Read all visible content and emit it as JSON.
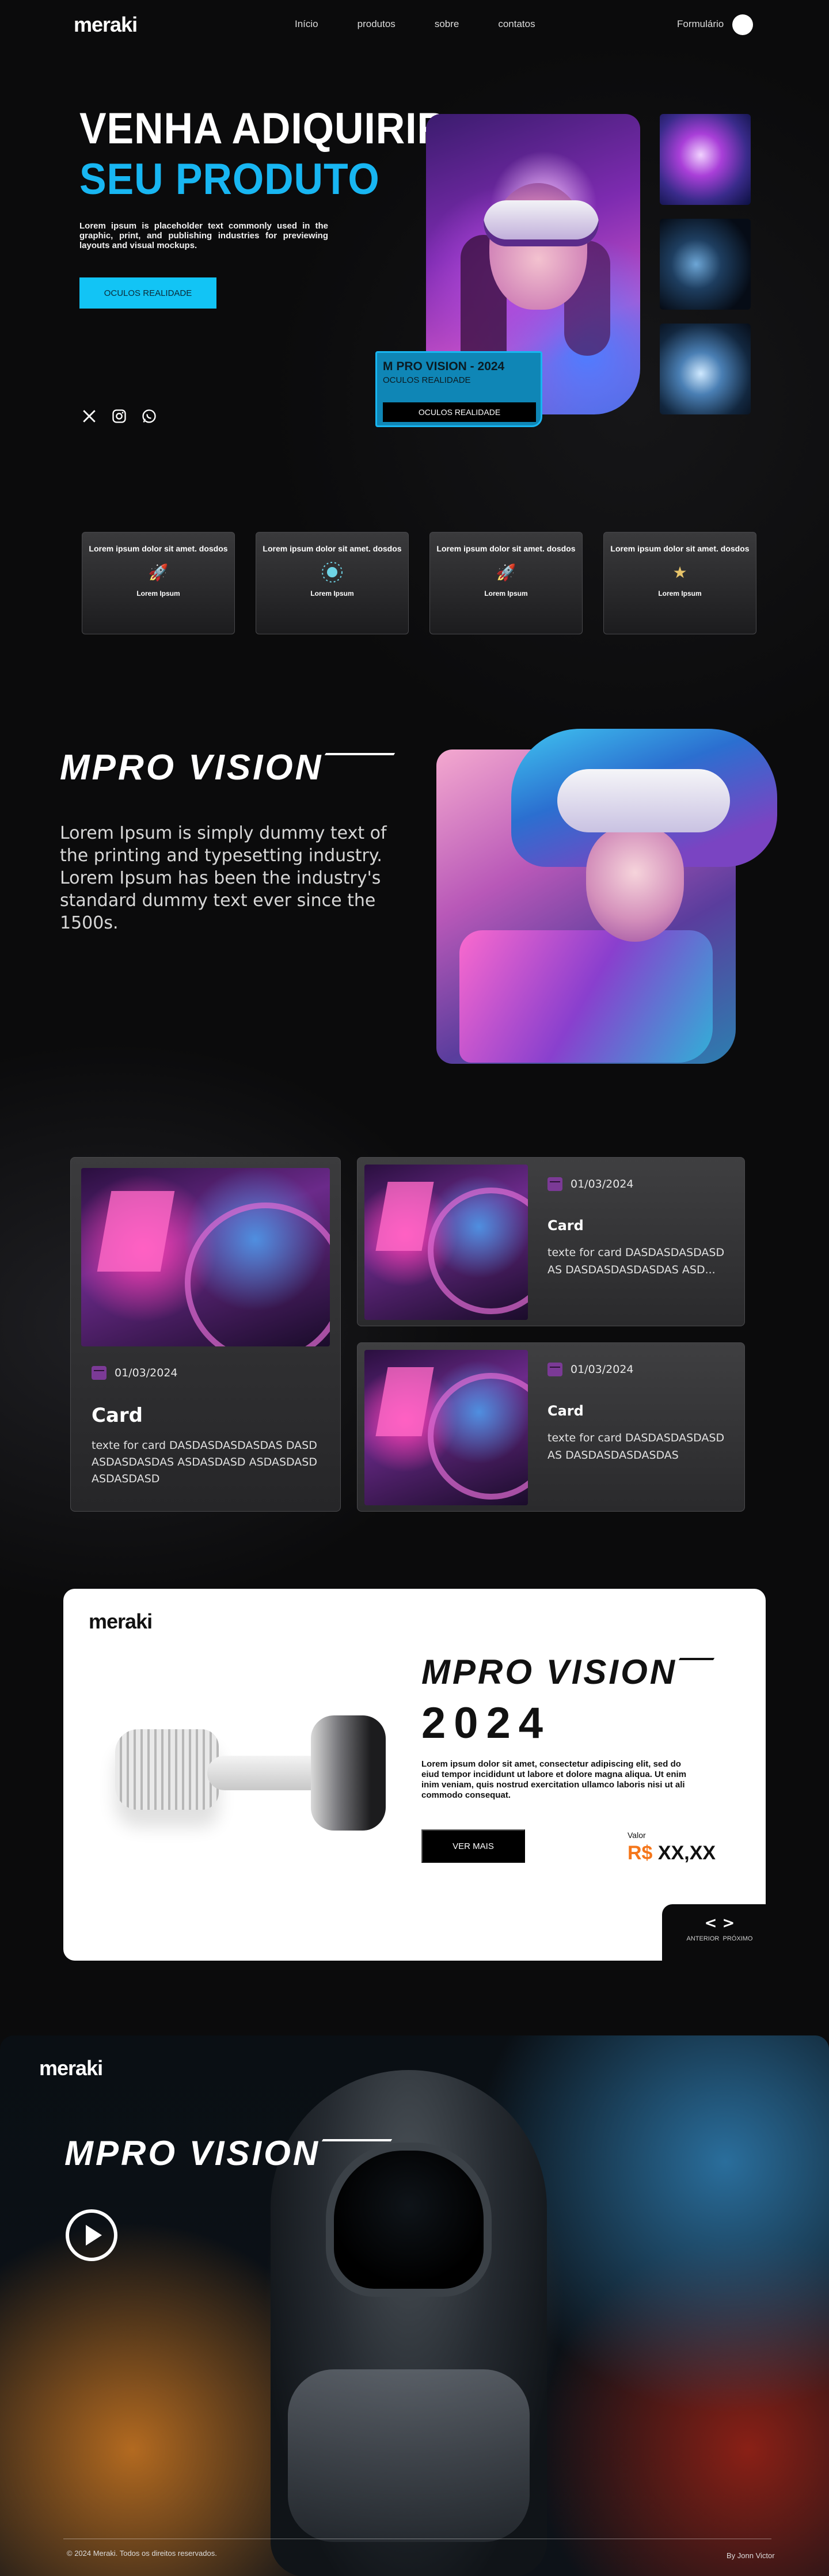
{
  "nav": {
    "logo": "meraki",
    "links": [
      "Início",
      "produtos",
      "sobre",
      "contatos"
    ],
    "form_label": "Formulário"
  },
  "hero": {
    "title_line1": "VENHA ADIQUIRIR",
    "title_line2": "SEU PRODUTO",
    "description": "Lorem ipsum is placeholder text commonly used in the graphic, print, and publishing industries for previewing layouts and visual mockups.",
    "button": "OCULOS REALIDADE",
    "tag_title": "M PRO VISION - 2024",
    "tag_subtitle": "OCULOS REALIDADE",
    "tag_button": "OCULOS REALIDADE",
    "socials": [
      "x-icon",
      "instagram-icon",
      "whatsapp-icon"
    ]
  },
  "features": [
    {
      "title": "Lorem ipsum dolor sit amet. dosdos",
      "icon": "rocket-icon",
      "label": "Lorem Ipsum"
    },
    {
      "title": "Lorem ipsum dolor sit amet. dosdos",
      "icon": "orbit-icon",
      "label": "Lorem Ipsum"
    },
    {
      "title": "Lorem ipsum dolor sit amet. dosdos",
      "icon": "rocket-icon",
      "label": "Lorem Ipsum"
    },
    {
      "title": "Lorem ipsum dolor sit amet. dosdos",
      "icon": "star-icon",
      "label": "Lorem Ipsum"
    }
  ],
  "vision": {
    "brand_1": "M",
    "brand_2": "PRO",
    "brand_3": "VISION",
    "text": "Lorem Ipsum  is simply dummy text of the printing and typesetting industry. Lorem  Ipsum has been the industry's standard dummy text ever since the  1500s."
  },
  "cards": {
    "big": {
      "date": "01/03/2024",
      "title": "Card",
      "text": "texte for card DASDASDASDASDAS DASDASDASDASDAS ASDASDASD ASDASDASDASDASDASD"
    },
    "small": [
      {
        "date": "01/03/2024",
        "title": "Card",
        "text": "texte for card DASDASDASDASDAS DASDASDASDASDAS ASD..."
      },
      {
        "date": "01/03/2024",
        "title": "Card",
        "text": "texte for card DASDASDASDASDAS DASDASDASDASDAS"
      }
    ]
  },
  "promo": {
    "logo": "meraki",
    "brand_1": "M",
    "brand_2": "PRO",
    "brand_3": "VISION",
    "year": "2024",
    "description": "Lorem ipsum dolor sit amet, consectetur adipiscing elit, sed do eiud tempor incididunt ut labore et dolore magna aliqua. Ut enim inim veniam, quis nostrud exercitation ullamco laboris nisi ut ali commodo consequat.",
    "button": "VER MAIS",
    "value_label": "Valor",
    "currency": "R$",
    "price": "XX,XX",
    "nav_prev": "ANTERIOR",
    "nav_next": "PRÓXIMO"
  },
  "footer": {
    "logo": "meraki",
    "brand_1": "M",
    "brand_2": "PRO",
    "brand_3": "VISION",
    "copyright": "© 2024 Meraki. Todos os direitos reservados.",
    "by": "By Jonn Victor"
  }
}
